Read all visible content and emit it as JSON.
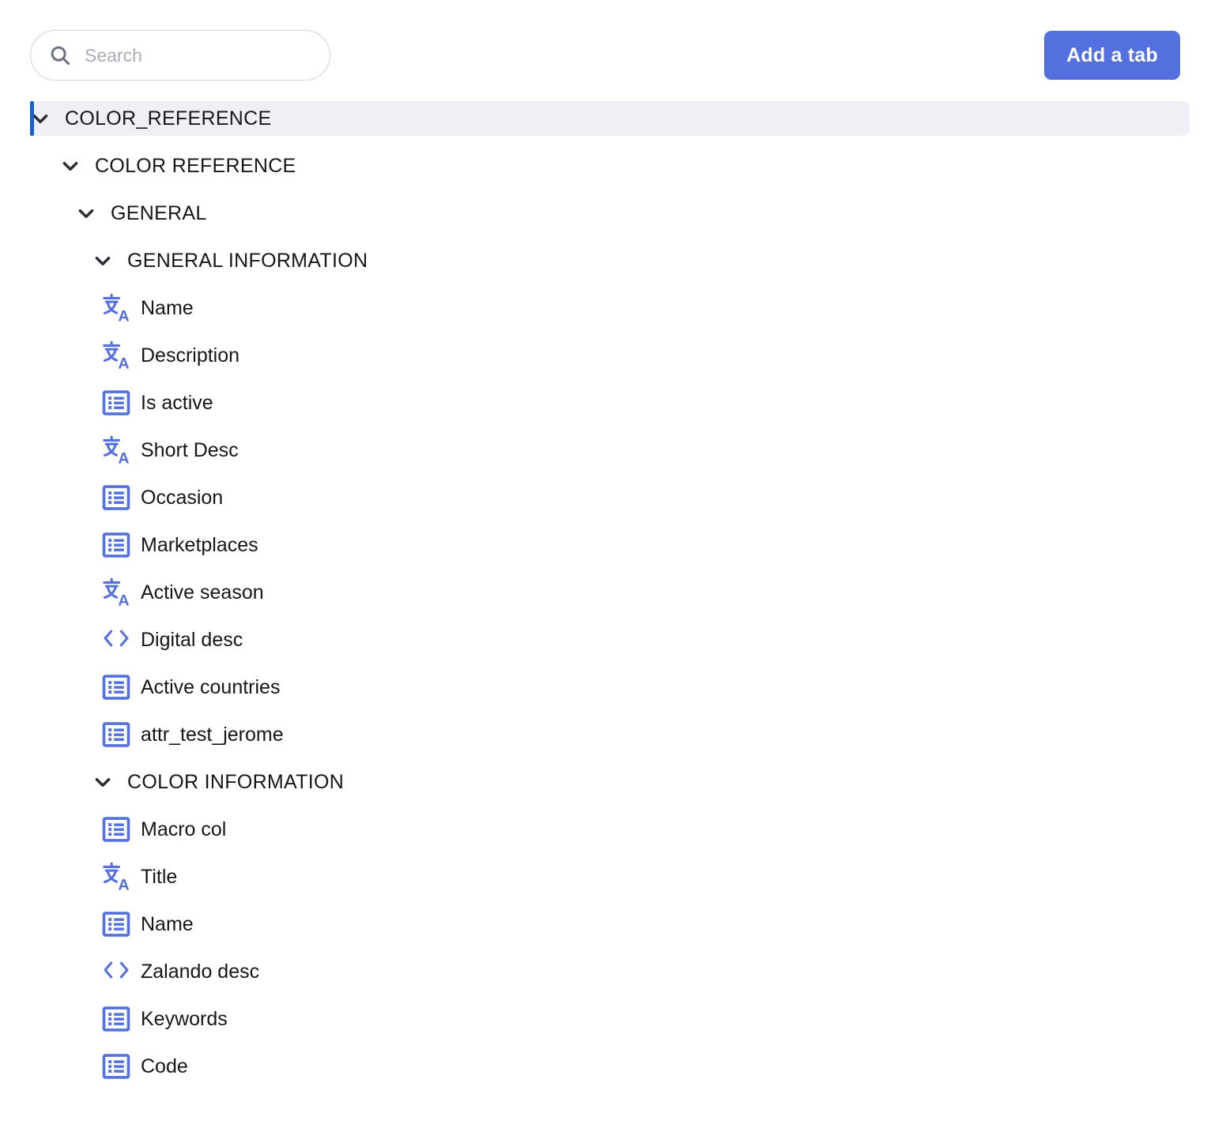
{
  "search": {
    "placeholder": "Search",
    "value": "",
    "icon": "search-icon"
  },
  "toolbar": {
    "add_tab_label": "Add a tab"
  },
  "colors": {
    "accent_blue": "#5470de",
    "selected_bar": "#1560d8",
    "selected_row_bg": "#eff0f5",
    "icon_blue": "#5470de",
    "text": "#15161a",
    "placeholder": "#a9adb7"
  },
  "tree": {
    "root": {
      "label": "COLOR_REFERENCE",
      "expanded": true,
      "selected": true,
      "chevron": "chevron-down-icon"
    },
    "nodes": [
      {
        "label": "COLOR REFERENCE",
        "kind": "group",
        "depth": 1,
        "icon": "chevron-down-icon"
      },
      {
        "label": "GENERAL",
        "kind": "group",
        "depth": 2,
        "icon": "chevron-down-icon"
      },
      {
        "label": "GENERAL INFORMATION",
        "kind": "group",
        "depth": 3,
        "icon": "chevron-down-icon"
      },
      {
        "label": "Name",
        "kind": "attr",
        "depth": 4,
        "icon": "translate-icon"
      },
      {
        "label": "Description",
        "kind": "attr",
        "depth": 4,
        "icon": "translate-icon"
      },
      {
        "label": "Is active",
        "kind": "attr",
        "depth": 4,
        "icon": "list-icon"
      },
      {
        "label": "Short Desc",
        "kind": "attr",
        "depth": 4,
        "icon": "translate-icon"
      },
      {
        "label": "Occasion",
        "kind": "attr",
        "depth": 4,
        "icon": "list-icon"
      },
      {
        "label": "Marketplaces",
        "kind": "attr",
        "depth": 4,
        "icon": "list-icon"
      },
      {
        "label": "Active season",
        "kind": "attr",
        "depth": 4,
        "icon": "translate-icon"
      },
      {
        "label": "Digital desc",
        "kind": "attr",
        "depth": 4,
        "icon": "code-icon"
      },
      {
        "label": "Active countries",
        "kind": "attr",
        "depth": 4,
        "icon": "list-icon"
      },
      {
        "label": "attr_test_jerome",
        "kind": "attr",
        "depth": 4,
        "icon": "list-icon"
      },
      {
        "label": "COLOR INFORMATION",
        "kind": "group",
        "depth": 3,
        "icon": "chevron-down-icon"
      },
      {
        "label": "Macro col",
        "kind": "attr",
        "depth": 4,
        "icon": "list-icon"
      },
      {
        "label": "Title",
        "kind": "attr",
        "depth": 4,
        "icon": "translate-icon"
      },
      {
        "label": "Name",
        "kind": "attr",
        "depth": 4,
        "icon": "list-icon"
      },
      {
        "label": "Zalando desc",
        "kind": "attr",
        "depth": 4,
        "icon": "code-icon"
      },
      {
        "label": "Keywords",
        "kind": "attr",
        "depth": 4,
        "icon": "list-icon"
      },
      {
        "label": "Code",
        "kind": "attr",
        "depth": 4,
        "icon": "list-icon"
      }
    ]
  }
}
